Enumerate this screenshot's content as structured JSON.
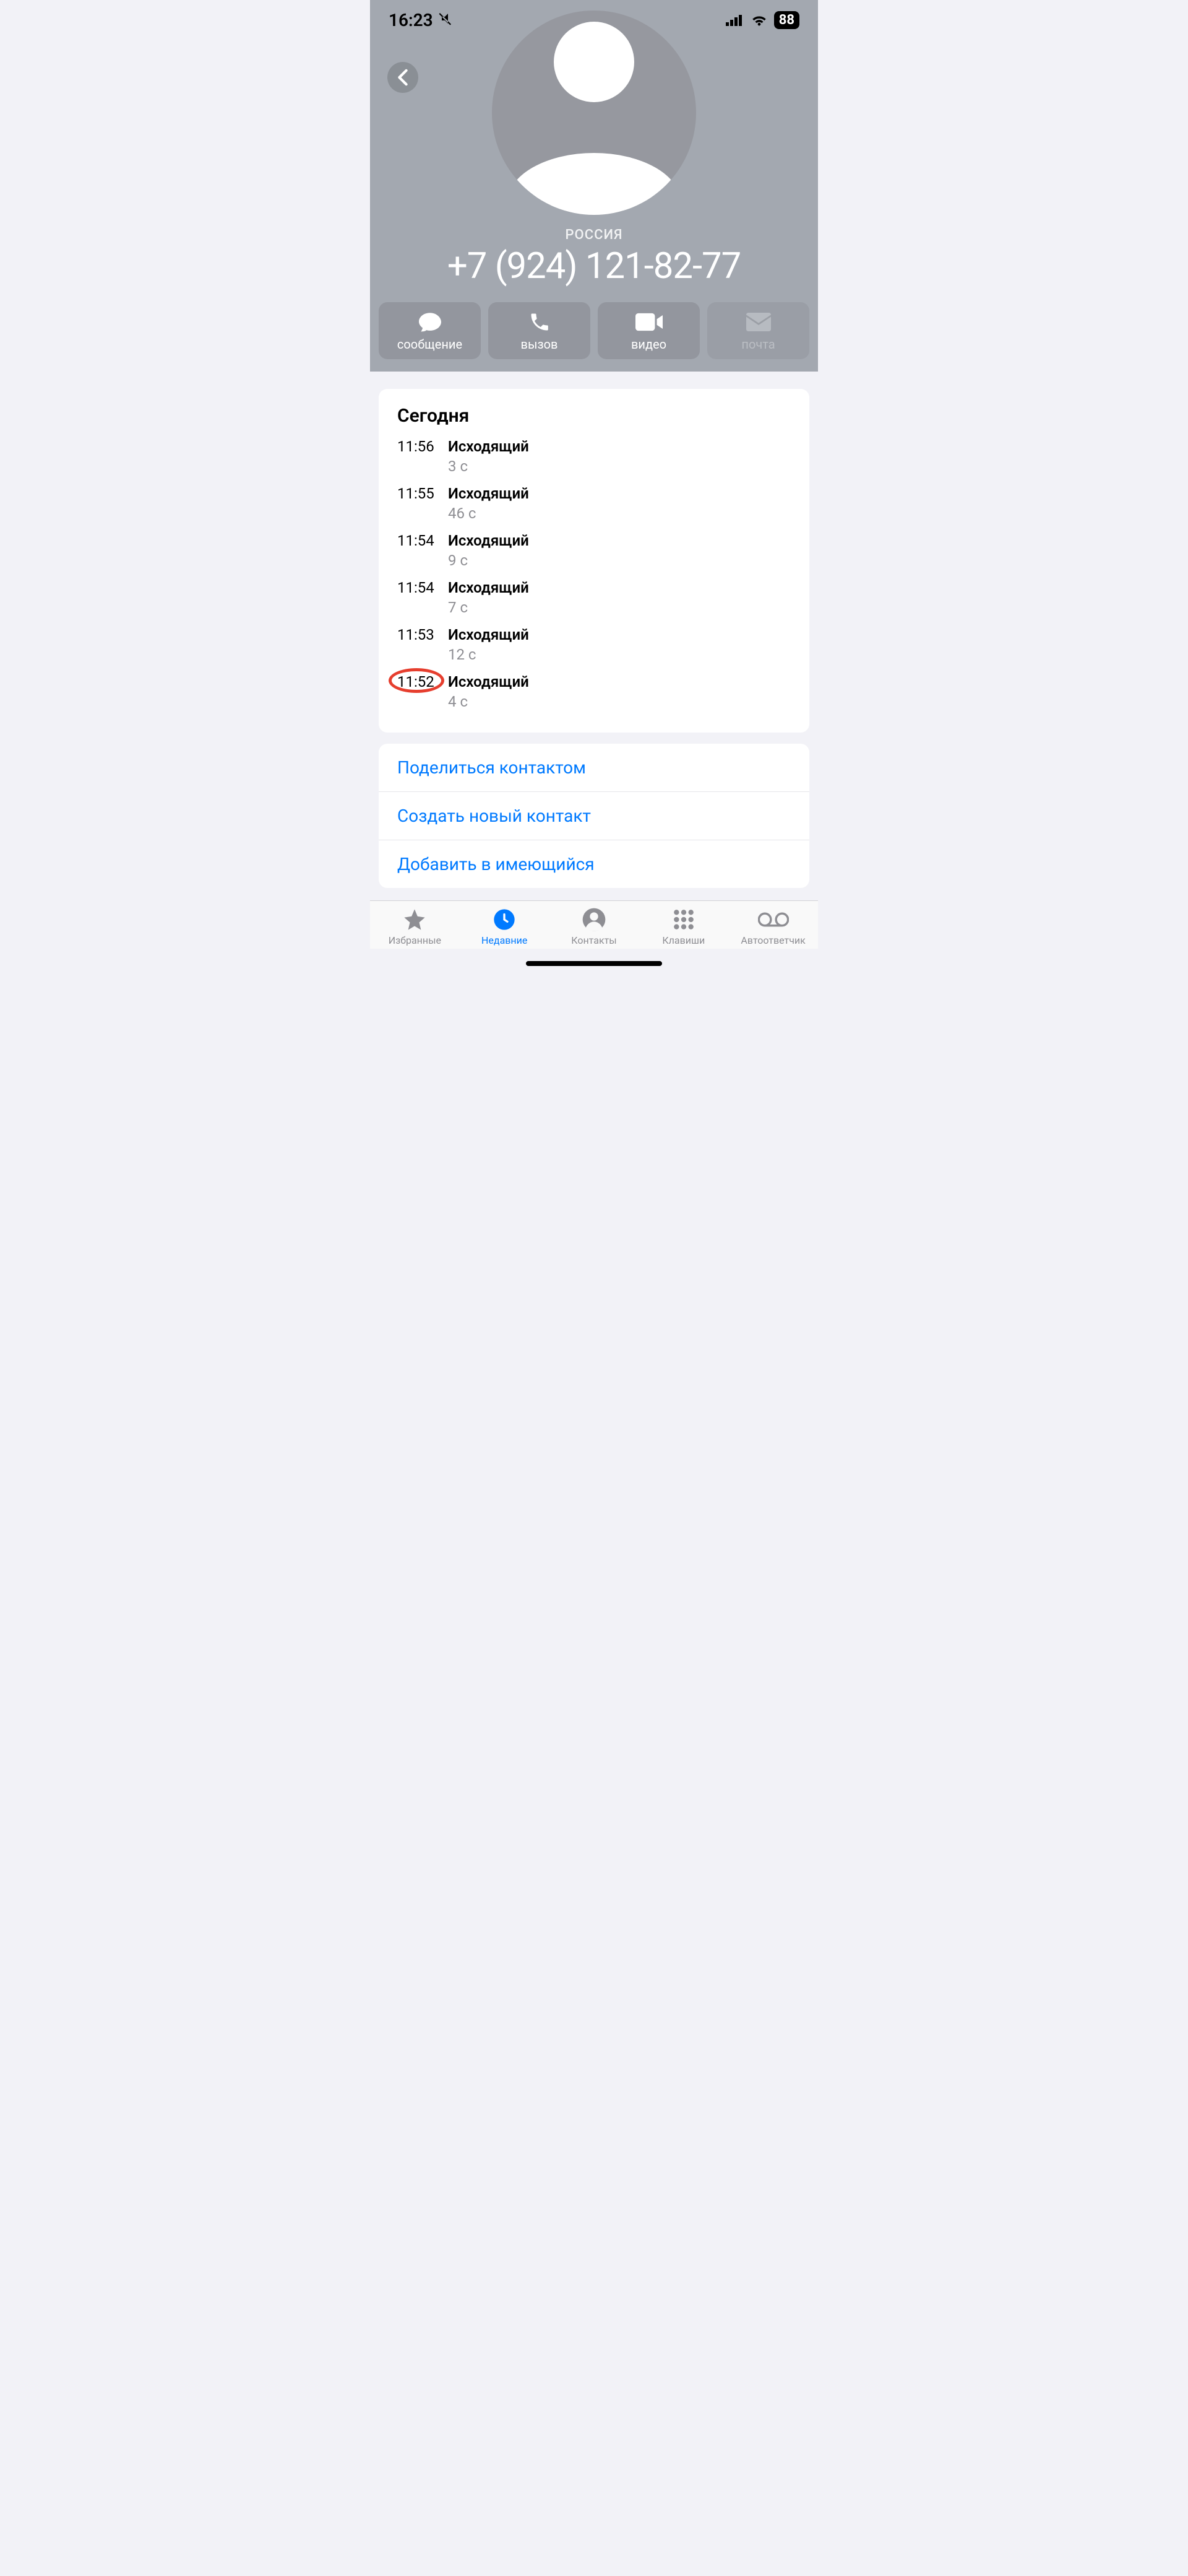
{
  "status": {
    "time": "16:23",
    "battery": "88"
  },
  "contact": {
    "country": "РОССИЯ",
    "phone": "+7 (924) 121-82-77"
  },
  "actions": {
    "message": "сообщение",
    "call": "вызов",
    "video": "видео",
    "mail": "почта"
  },
  "history": {
    "title": "Сегодня",
    "calls": [
      {
        "time": "11:56",
        "type": "Исходящий",
        "duration": "3 с"
      },
      {
        "time": "11:55",
        "type": "Исходящий",
        "duration": "46 с"
      },
      {
        "time": "11:54",
        "type": "Исходящий",
        "duration": "9 с"
      },
      {
        "time": "11:54",
        "type": "Исходящий",
        "duration": "7 с"
      },
      {
        "time": "11:53",
        "type": "Исходящий",
        "duration": "12 с"
      },
      {
        "time": "11:52",
        "type": "Исходящий",
        "duration": "4 с"
      }
    ]
  },
  "links": {
    "share": "Поделиться контактом",
    "create": "Создать новый контакт",
    "add": "Добавить в имеющийся"
  },
  "tabs": {
    "favorites": "Избранные",
    "recents": "Недавние",
    "contacts": "Контакты",
    "keypad": "Клавиши",
    "voicemail": "Автоответчик"
  }
}
